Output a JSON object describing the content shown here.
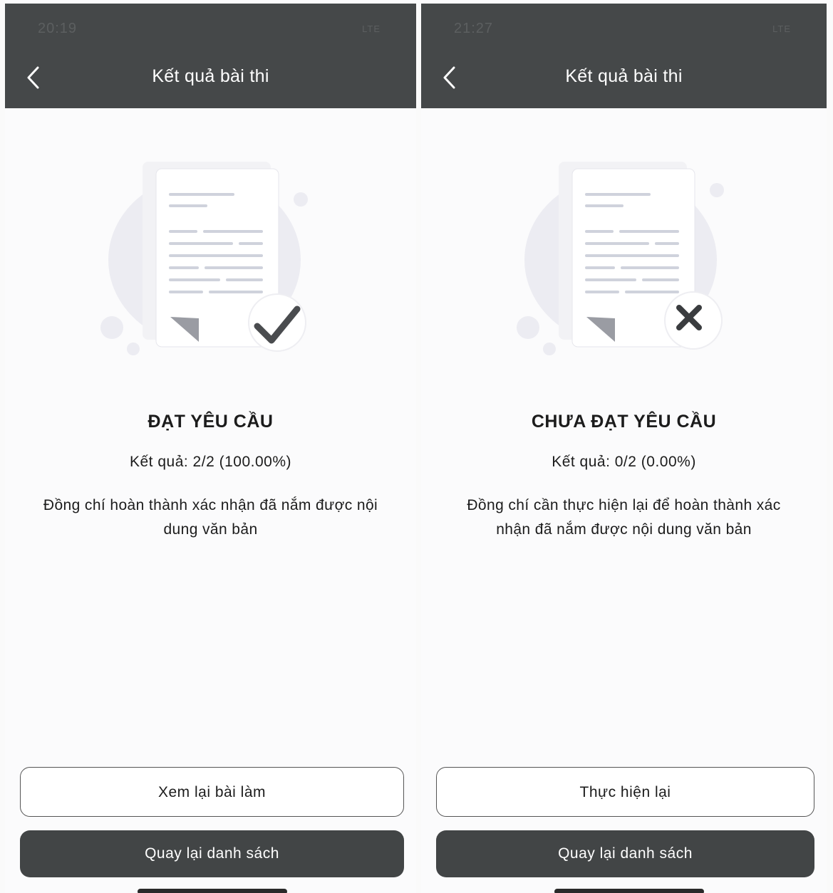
{
  "left": {
    "status_time": "20:19",
    "status_right": "LTE",
    "title": "Kết quả bài thi",
    "heading": "ĐẠT YÊU CẦU",
    "result": "Kết quả: 2/2 (100.00%)",
    "message": "Đồng chí hoàn thành xác nhận đã nắm được nội dung văn bản",
    "secondary_button": "Xem lại bài làm",
    "primary_button": "Quay lại danh sách",
    "badge_icon": "checkmark-icon"
  },
  "right": {
    "status_time": "21:27",
    "status_right": "LTE",
    "title": "Kết quả bài thi",
    "heading": "CHƯA ĐẠT YÊU CẦU",
    "result": "Kết quả: 0/2 (0.00%)",
    "message": "Đồng chí cần thực hiện lại để hoàn thành xác nhận đã nắm được nội dung văn bản",
    "secondary_button": "Thực hiện lại",
    "primary_button": "Quay lại danh sách",
    "badge_icon": "x-mark-icon"
  },
  "colors": {
    "header_bg": "#454849",
    "primary_button_bg": "#424546",
    "background": "#fbfbfc"
  }
}
